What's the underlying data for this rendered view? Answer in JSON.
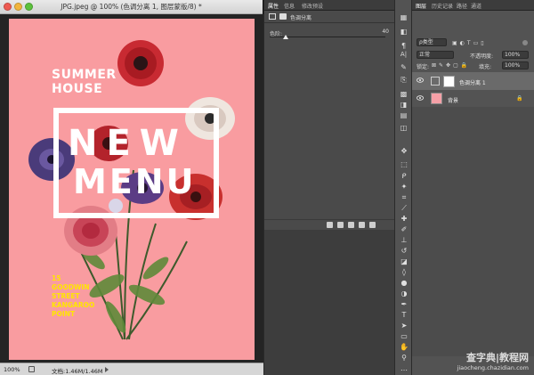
{
  "document": {
    "title": "JPG.jpeg @ 100% (色调分离 1, 图层蒙版/8) *",
    "zoom": "100%",
    "file_info": "文档:1.46M/1.46M"
  },
  "poster": {
    "headline_top": [
      "SUMMER",
      "HOUSE"
    ],
    "headline_new": "NEW",
    "headline_menu": "MENU",
    "address": [
      "15",
      "GOODWIN",
      "STREET",
      "KANGAROO",
      "POINT"
    ]
  },
  "properties_panel": {
    "tabs": [
      "属性",
      "信息",
      "修改预设"
    ],
    "adjustment_title": "色调分离",
    "levels_label": "色阶:",
    "levels_value": "40",
    "levels_fraction": 0.14
  },
  "layers_panel": {
    "tabs": [
      "图层",
      "历史记录",
      "路径",
      "通道"
    ],
    "filter_kind": "ρ类型",
    "blend_mode": "正常",
    "opacity_label": "不透明度:",
    "opacity_value": "100%",
    "lock_label": "锁定:",
    "fill_label": "填充:",
    "fill_value": "100%",
    "layers": [
      {
        "name": "色调分离 1",
        "selected": true
      },
      {
        "name": "背景",
        "selected": false
      }
    ]
  },
  "watermark": {
    "line1": "查字典|教程网",
    "line2": "jiaocheng.chazidian.com"
  },
  "colors": {
    "poster_bg": "#f99ca0",
    "address_yellow": "#ffe600",
    "panel_bg": "#535353"
  }
}
